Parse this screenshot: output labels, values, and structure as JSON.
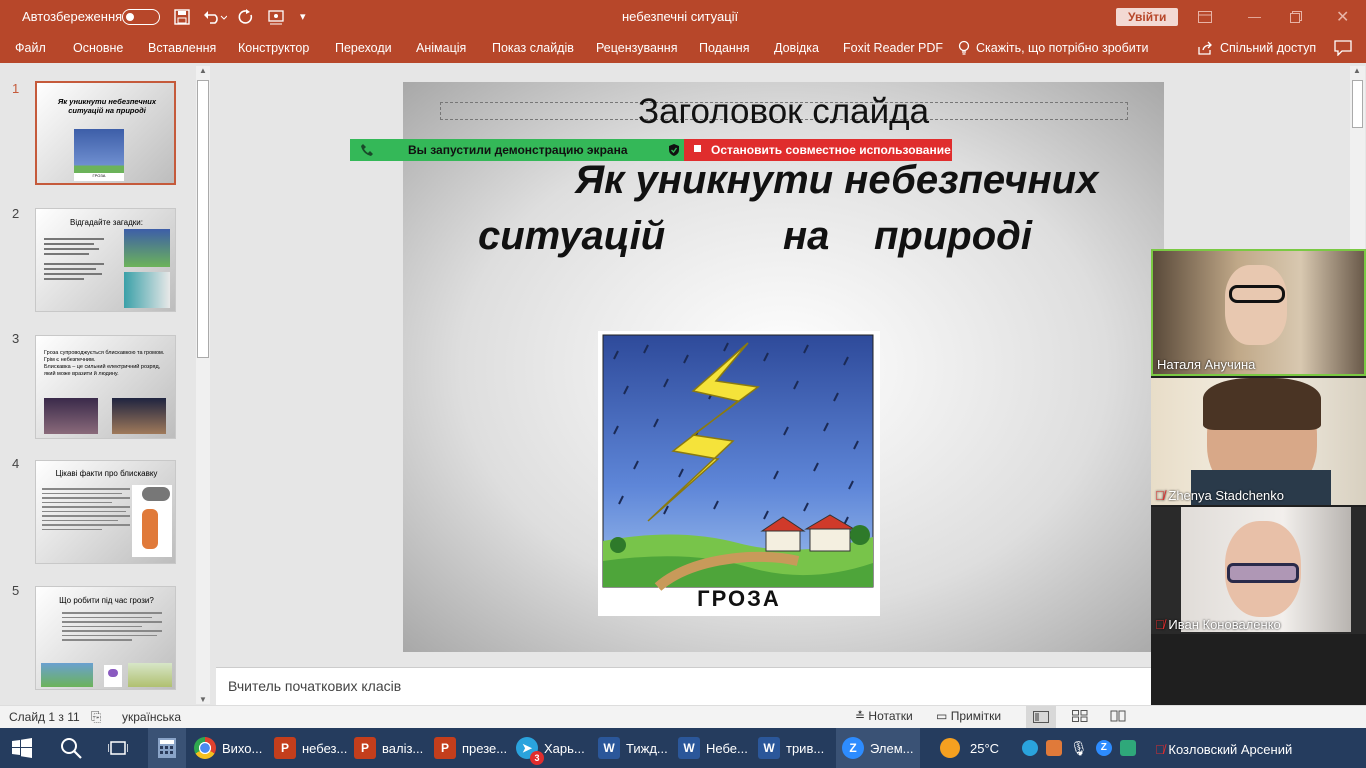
{
  "titlebar": {
    "autosave_label": "Автозбереження",
    "document_title": "небезпечні ситуації",
    "signin_label": "Увійти"
  },
  "ribbon": {
    "tabs": [
      "Файл",
      "Основне",
      "Вставлення",
      "Конструктор",
      "Переходи",
      "Анімація",
      "Показ слайдів",
      "Рецензування",
      "Подання",
      "Довідка",
      "Foxit Reader PDF"
    ],
    "tell_me": "Скажіть, що потрібно зробити",
    "share": "Спільний доступ"
  },
  "thumbnails": [
    {
      "num": "1",
      "title": "Як уникнути небезпечних ситуацій на природі",
      "caption": "ГРОЗА"
    },
    {
      "num": "2",
      "title": "Відгадайте загадки:"
    },
    {
      "num": "3",
      "bullets": [
        "Гроза супроводжується блискавкою та громом.",
        "Грім є небезпечним.",
        "Блискавка – це сильний електричний розряд, який може вразити й людину."
      ]
    },
    {
      "num": "4",
      "title": "Цікаві факти про блискавку"
    },
    {
      "num": "5",
      "title": "Що робити під час грози?"
    }
  ],
  "slide": {
    "placeholder_title": "Заголовок слайда",
    "heading_line1": "Як уникнути небезпечних",
    "heading_line2_a": "ситуацій",
    "heading_line2_b": "на",
    "heading_line2_c": "природі",
    "image_caption": "ГРОЗА"
  },
  "screen_share": {
    "status": "Вы запустили демонстрацию экрана",
    "stop": "Остановить совместное использование"
  },
  "notes": {
    "text": "Вчитель початкових класів"
  },
  "statusbar": {
    "slide_counter": "Слайд 1 з 11",
    "language": "українська",
    "notes_label": "Нотатки",
    "comments_label": "Примітки"
  },
  "participants": [
    {
      "name": "Наталя Анучина",
      "muted": false
    },
    {
      "name": "Zhenya Stadchenko",
      "muted": true
    },
    {
      "name": "Иван Коноваленко",
      "muted": true
    },
    {
      "name": "Козловский Арсений",
      "muted": true
    }
  ],
  "taskbar": {
    "apps": [
      {
        "label": "Вихо...",
        "icon": "chrome-icon",
        "color": "#fff"
      },
      {
        "label": "небез...",
        "icon": "powerpoint-icon",
        "color": "#c43e1c"
      },
      {
        "label": "валіз...",
        "icon": "powerpoint-icon",
        "color": "#c43e1c"
      },
      {
        "label": "презе...",
        "icon": "powerpoint-icon",
        "color": "#c43e1c"
      },
      {
        "label": "Харь...",
        "icon": "telegram-icon",
        "color": "#2aa3dd"
      },
      {
        "label": "Тижд...",
        "icon": "word-icon",
        "color": "#2b579a"
      },
      {
        "label": "Небе...",
        "icon": "word-icon",
        "color": "#2b579a"
      },
      {
        "label": "трив...",
        "icon": "word-icon",
        "color": "#2b579a"
      },
      {
        "label": "Элем...",
        "icon": "zoom-icon",
        "color": "#2d8cff"
      }
    ],
    "telegram_badge": "3",
    "temperature": "25°C"
  },
  "colors": {
    "accent": "#b7472a",
    "share_green": "#34b858",
    "share_red": "#e02d2d",
    "taskbar": "#253c5e"
  }
}
